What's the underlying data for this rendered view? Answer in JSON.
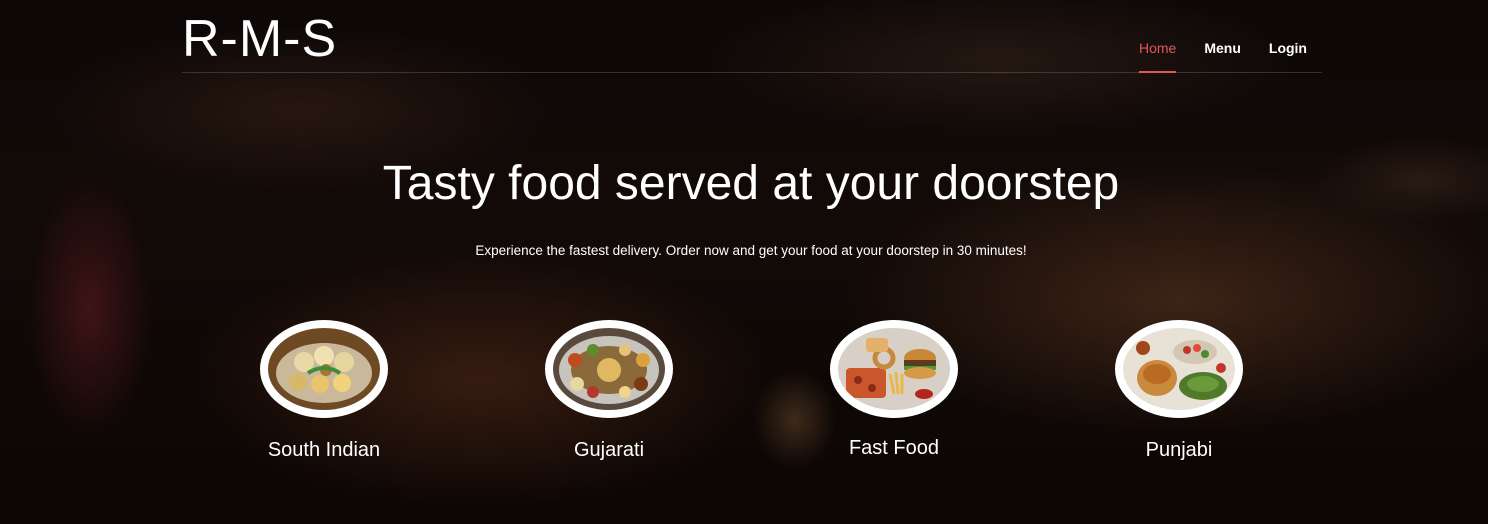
{
  "header": {
    "brand": "R-M-S",
    "nav": [
      {
        "label": "Home",
        "active": true
      },
      {
        "label": "Menu",
        "active": false
      },
      {
        "label": "Login",
        "active": false
      }
    ],
    "accent_color": "#e0585c"
  },
  "hero": {
    "title": "Tasty food served at your doorstep",
    "subtitle": "Experience the fastest delivery. Order now and get your food at your doorstep in 30 minutes!"
  },
  "categories": [
    {
      "label": "South Indian",
      "icon": "south-indian-dish-icon"
    },
    {
      "label": "Gujarati",
      "icon": "gujarati-thali-icon"
    },
    {
      "label": "Fast Food",
      "icon": "fast-food-platter-icon"
    },
    {
      "label": "Punjabi",
      "icon": "punjabi-dish-icon"
    }
  ]
}
